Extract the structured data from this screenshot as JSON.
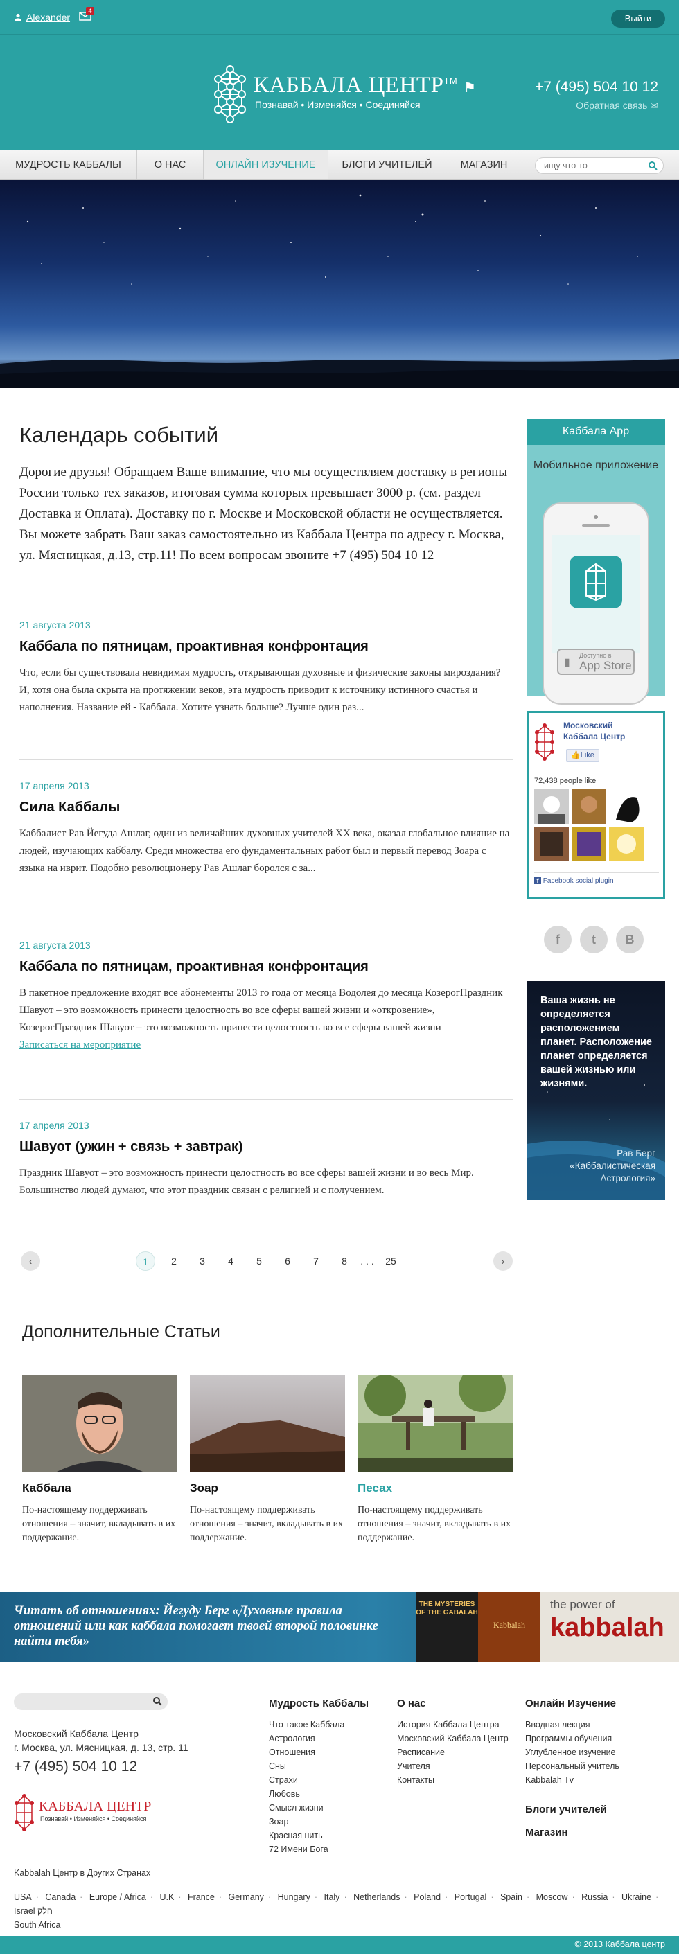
{
  "topbar": {
    "username": "Alexander",
    "mail_count": "4",
    "logout_label": "Выйти",
    "icons": {
      "user": "user-icon",
      "mail": "mail-icon"
    }
  },
  "header": {
    "brand": "КАББАЛА ЦЕНТР",
    "brand_tm": "TM",
    "tagline": "Познавай • Изменяйся • Соединяйся",
    "phone": "+7 (495) 504 10 12",
    "feedback": "Обратная связь",
    "bg_color": "#2aa2a3"
  },
  "nav": {
    "items": [
      {
        "label": "МУДРОСТЬ КАББАЛЫ",
        "active": false
      },
      {
        "label": "О НАС",
        "active": false
      },
      {
        "label": "ОНЛАЙН ИЗУЧЕНИЕ",
        "active": true
      },
      {
        "label": "БЛОГИ УЧИТЕЛЕЙ",
        "active": false
      },
      {
        "label": "МАГАЗИН",
        "active": false
      }
    ],
    "search_placeholder": "ищу что-то"
  },
  "main": {
    "title": "Календарь событий",
    "intro": "Дорогие друзья! Обращаем Ваше внимание, что мы осуществляем доставку в регионы России только тех заказов, итоговая сумма которых превышает 3000 р. (см. раздел Доставка и Оплата). Доставку по г. Москве и Московской области не осуществляется. Вы можете забрать Ваш заказ самостоятельно из Каббала Центра по адресу г. Москва, ул. Мясницкая, д.13, стр.11! По всем вопросам звоните +7 (495) 504 10 12",
    "events": [
      {
        "date": "21 августа 2013",
        "title": "Каббала по пятницам, проактивная конфронтация",
        "desc": "Что, если бы существовала невидимая мудрость, открывающая духовные и физические законы мироздания? И, хотя она была скрыта на протяжении веков, эта мудрость приводит к источнику истинного счастья и наполнения. Название ей - Каббала. Хотите узнать больше? Лучше один раз...",
        "link": ""
      },
      {
        "date": "17 апреля 2013",
        "title": "Сила Каббалы",
        "desc": "Каббалист Рав Йегуда Ашлаг, один из величайших духовных учителей XX века, оказал глобальное влияние на людей, изучающих каббалу. Среди множества его фундаментальных работ был и первый перевод Зоара с языка на иврит. Подобно революционеру Рав Ашлаг боролся с за...",
        "link": ""
      },
      {
        "date": "21 августа 2013",
        "title": "Каббала по пятницам, проактивная конфронтация",
        "desc": "В пакетное предложение входят все абонементы 2013 го года от месяца Водолея до месяца КозерогПраздник Шавуот – это возможность принести целостность во все сферы вашей жизни и «откровение», КозерогПраздник Шавуот – это возможность принести целостность во все сферы вашей жизни",
        "link": "Записаться на мероприятие"
      },
      {
        "date": "17 апреля 2013",
        "title": "Шавуот (ужин + связь + завтрак)",
        "desc": "Праздник Шавуот – это возможность принести целостность во все сферы вашей жизни и во весь Мир. Большинство людей думают, что этот праздник связан с религией и с получением.",
        "link": ""
      }
    ],
    "pagination": {
      "prev": "‹",
      "next": "›",
      "pages": [
        "1",
        "2",
        "3",
        "4",
        "5",
        "6",
        "7",
        "8"
      ],
      "ellipsis": ". . .",
      "last": "25",
      "current": "1"
    },
    "more_title": "Дополнительные Статьи",
    "articles": [
      {
        "title": "Каббала",
        "text": "По-настоящему поддерживать отношения – значит, вкладывать в их поддержание."
      },
      {
        "title": "Зоар",
        "text": "По-настоящему поддерживать отношения – значит, вкладывать в их поддержание."
      },
      {
        "title": "Песах",
        "text": "По-настоящему поддерживать отношения – значит, вкладывать в их поддержание.",
        "highlight": true
      }
    ]
  },
  "sidebar": {
    "app_title": "Каббала App",
    "app_sub": "Мобильное приложение",
    "appstore_small": "Доступно в",
    "appstore_big": "App Store",
    "fb": {
      "page_name": "Московский Каббала Центр",
      "like_label": "Like",
      "likes": "72,438 people like",
      "plugin": "Facebook social plugin"
    },
    "social": [
      "f",
      "t",
      "B"
    ],
    "quote": "Ваша жизнь не определяется расположением планет. Расположение планет определяется вашей жизнью или жизнями.",
    "quote_author": "Рав Берг «Каббалистическая Астрология»"
  },
  "banner": {
    "text": "Читать об отношениях: Йегуду Берг «Духовные правила отношений или как каббала помогает твоей второй половинке найти тебя»",
    "book_right_line1": "the power of",
    "book_right_line2": "kabbalah",
    "book_left": "THE MYSTERIES OF THE GABALAH",
    "book_mid": "Kabbalah"
  },
  "footer": {
    "address1": "Московский Каббала Центр",
    "address2": "г. Москва, ул. Мясницкая, д. 13, стр. 11",
    "phone": "+7 (495) 504 10 12",
    "logo_brand": "КАББАЛА ЦЕНТР",
    "logo_tagline": "Познавай • Изменяйся • Соединяйся",
    "col1": {
      "title": "Мудрость Каббалы",
      "items": [
        "Что такое Каббала",
        "Астрология",
        "Отношения",
        "Сны",
        "Страхи",
        "Любовь",
        "Смысл жизни",
        "Зоар",
        "Красная нить",
        "72 Имени Бога"
      ]
    },
    "col2": {
      "title": "О нас",
      "items": [
        "История Каббала Центра",
        "Московский Каббала Центр",
        "Расписание",
        "Учителя",
        "Контакты"
      ]
    },
    "col3": {
      "title": "Онлайн Изучение",
      "items": [
        "Вводная лекция",
        "Программы обучения",
        "Углубленное изучение",
        "Персональный учитель",
        "Kabbalah Tv"
      ],
      "extra": [
        "Блоги учителей",
        "Магазин"
      ]
    },
    "other_centers": "Kabbalah Центр в Других Странах",
    "countries": [
      "USA",
      "Canada",
      "Europe / Africa",
      "U.K",
      "France",
      "Germany",
      "Hungary",
      "Italy",
      "Netherlands",
      "Poland",
      "Portugal",
      "Spain",
      "Moscow",
      "Russia",
      "Ukraine",
      "Israel הלק",
      "South Africa"
    ],
    "copyright": "© 2013 Каббала центр"
  }
}
